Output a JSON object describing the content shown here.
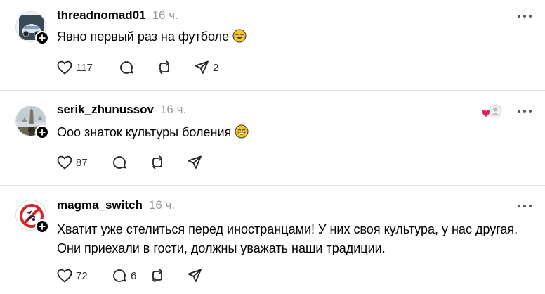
{
  "colors": {
    "text": "#000000",
    "muted": "#999999",
    "divider": "#e5e5e5",
    "heart": "#e0245e"
  },
  "posts": [
    {
      "username": "threadnomad01",
      "timestamp": "16 ч.",
      "text": "Явно первый раз на футболе",
      "emoji": "tears-of-joy-emoji",
      "likes": "117",
      "replies": "",
      "reposts": "",
      "shares": "2"
    },
    {
      "username": "serik_zhunussov",
      "timestamp": "16 ч.",
      "text": "Ооо знаток культуры боления",
      "emoji": "grinning-sweat-emoji",
      "likes": "87",
      "replies": "",
      "reposts": "",
      "shares": "",
      "liked_by_author": true
    },
    {
      "username": "magma_switch",
      "timestamp": "16 ч.",
      "text_line1": "Хватит уже стелиться перед иностранцами! У них своя культура, у нас другая.",
      "text_line2": "Они приехали в гости, должны уважать наши традиции.",
      "likes": "72",
      "replies": "6",
      "reposts": "",
      "shares": ""
    }
  ],
  "icons": {
    "like": "heart-icon",
    "reply": "comment-icon",
    "repost": "repost-icon",
    "share": "send-icon",
    "more": "more-icon",
    "follow": "plus-icon"
  }
}
